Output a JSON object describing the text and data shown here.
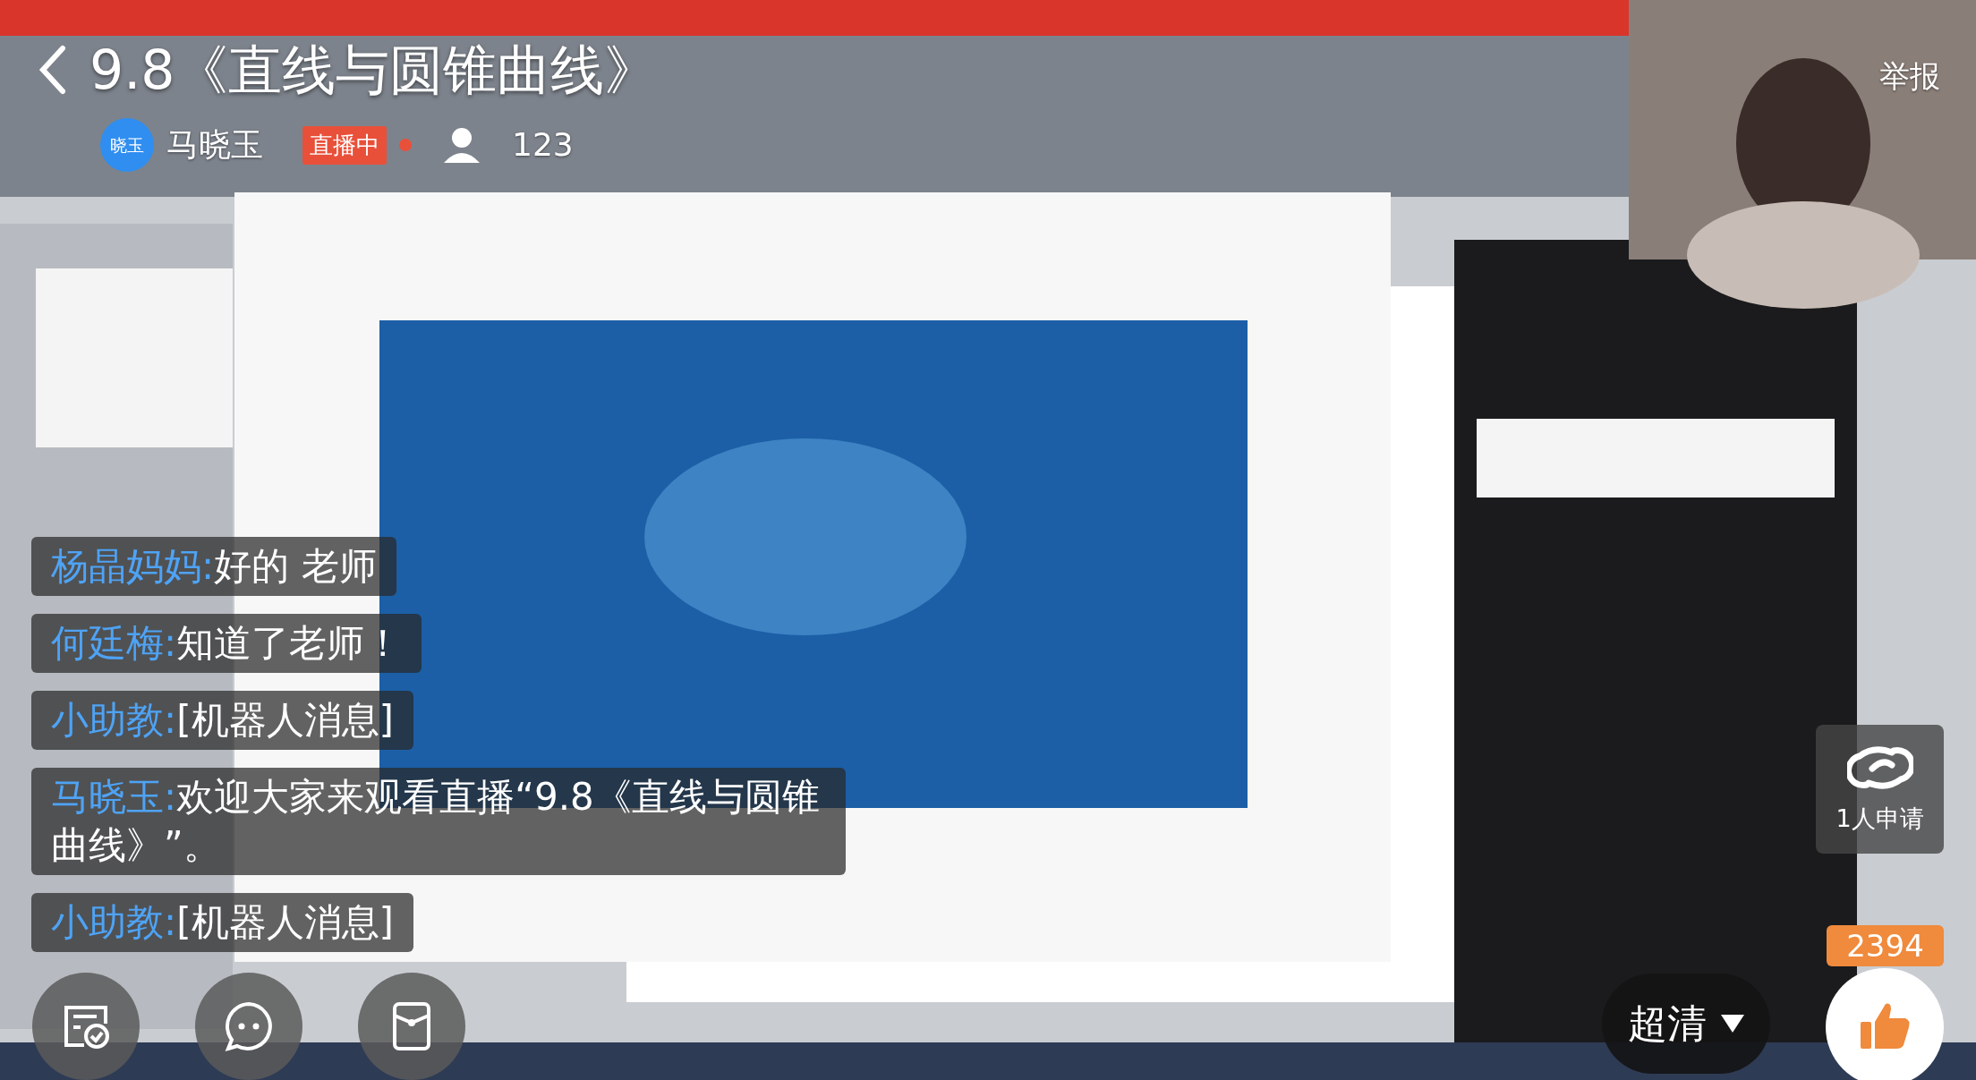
{
  "title": "9.8《直线与圆锥曲线》",
  "host": {
    "avatar_text": "晓玉",
    "name": "马晓玉"
  },
  "live_badge": "直播中",
  "viewer_count": "123",
  "report_button": "举报",
  "chat_messages": [
    {
      "sender": "杨晶妈妈:",
      "text": "好的 老师"
    },
    {
      "sender": "何廷梅:",
      "text": "知道了老师！"
    },
    {
      "sender": "小助教:",
      "text": "[机器人消息]"
    },
    {
      "sender": "马晓玉:",
      "text": "欢迎大家来观看直播“9.8《直线与圆锥曲线》”。"
    },
    {
      "sender": "小助教:",
      "text": "[机器人消息]"
    }
  ],
  "link_requests": {
    "label": "1人申请"
  },
  "like_count": "2394",
  "quality": {
    "label": "超清"
  }
}
